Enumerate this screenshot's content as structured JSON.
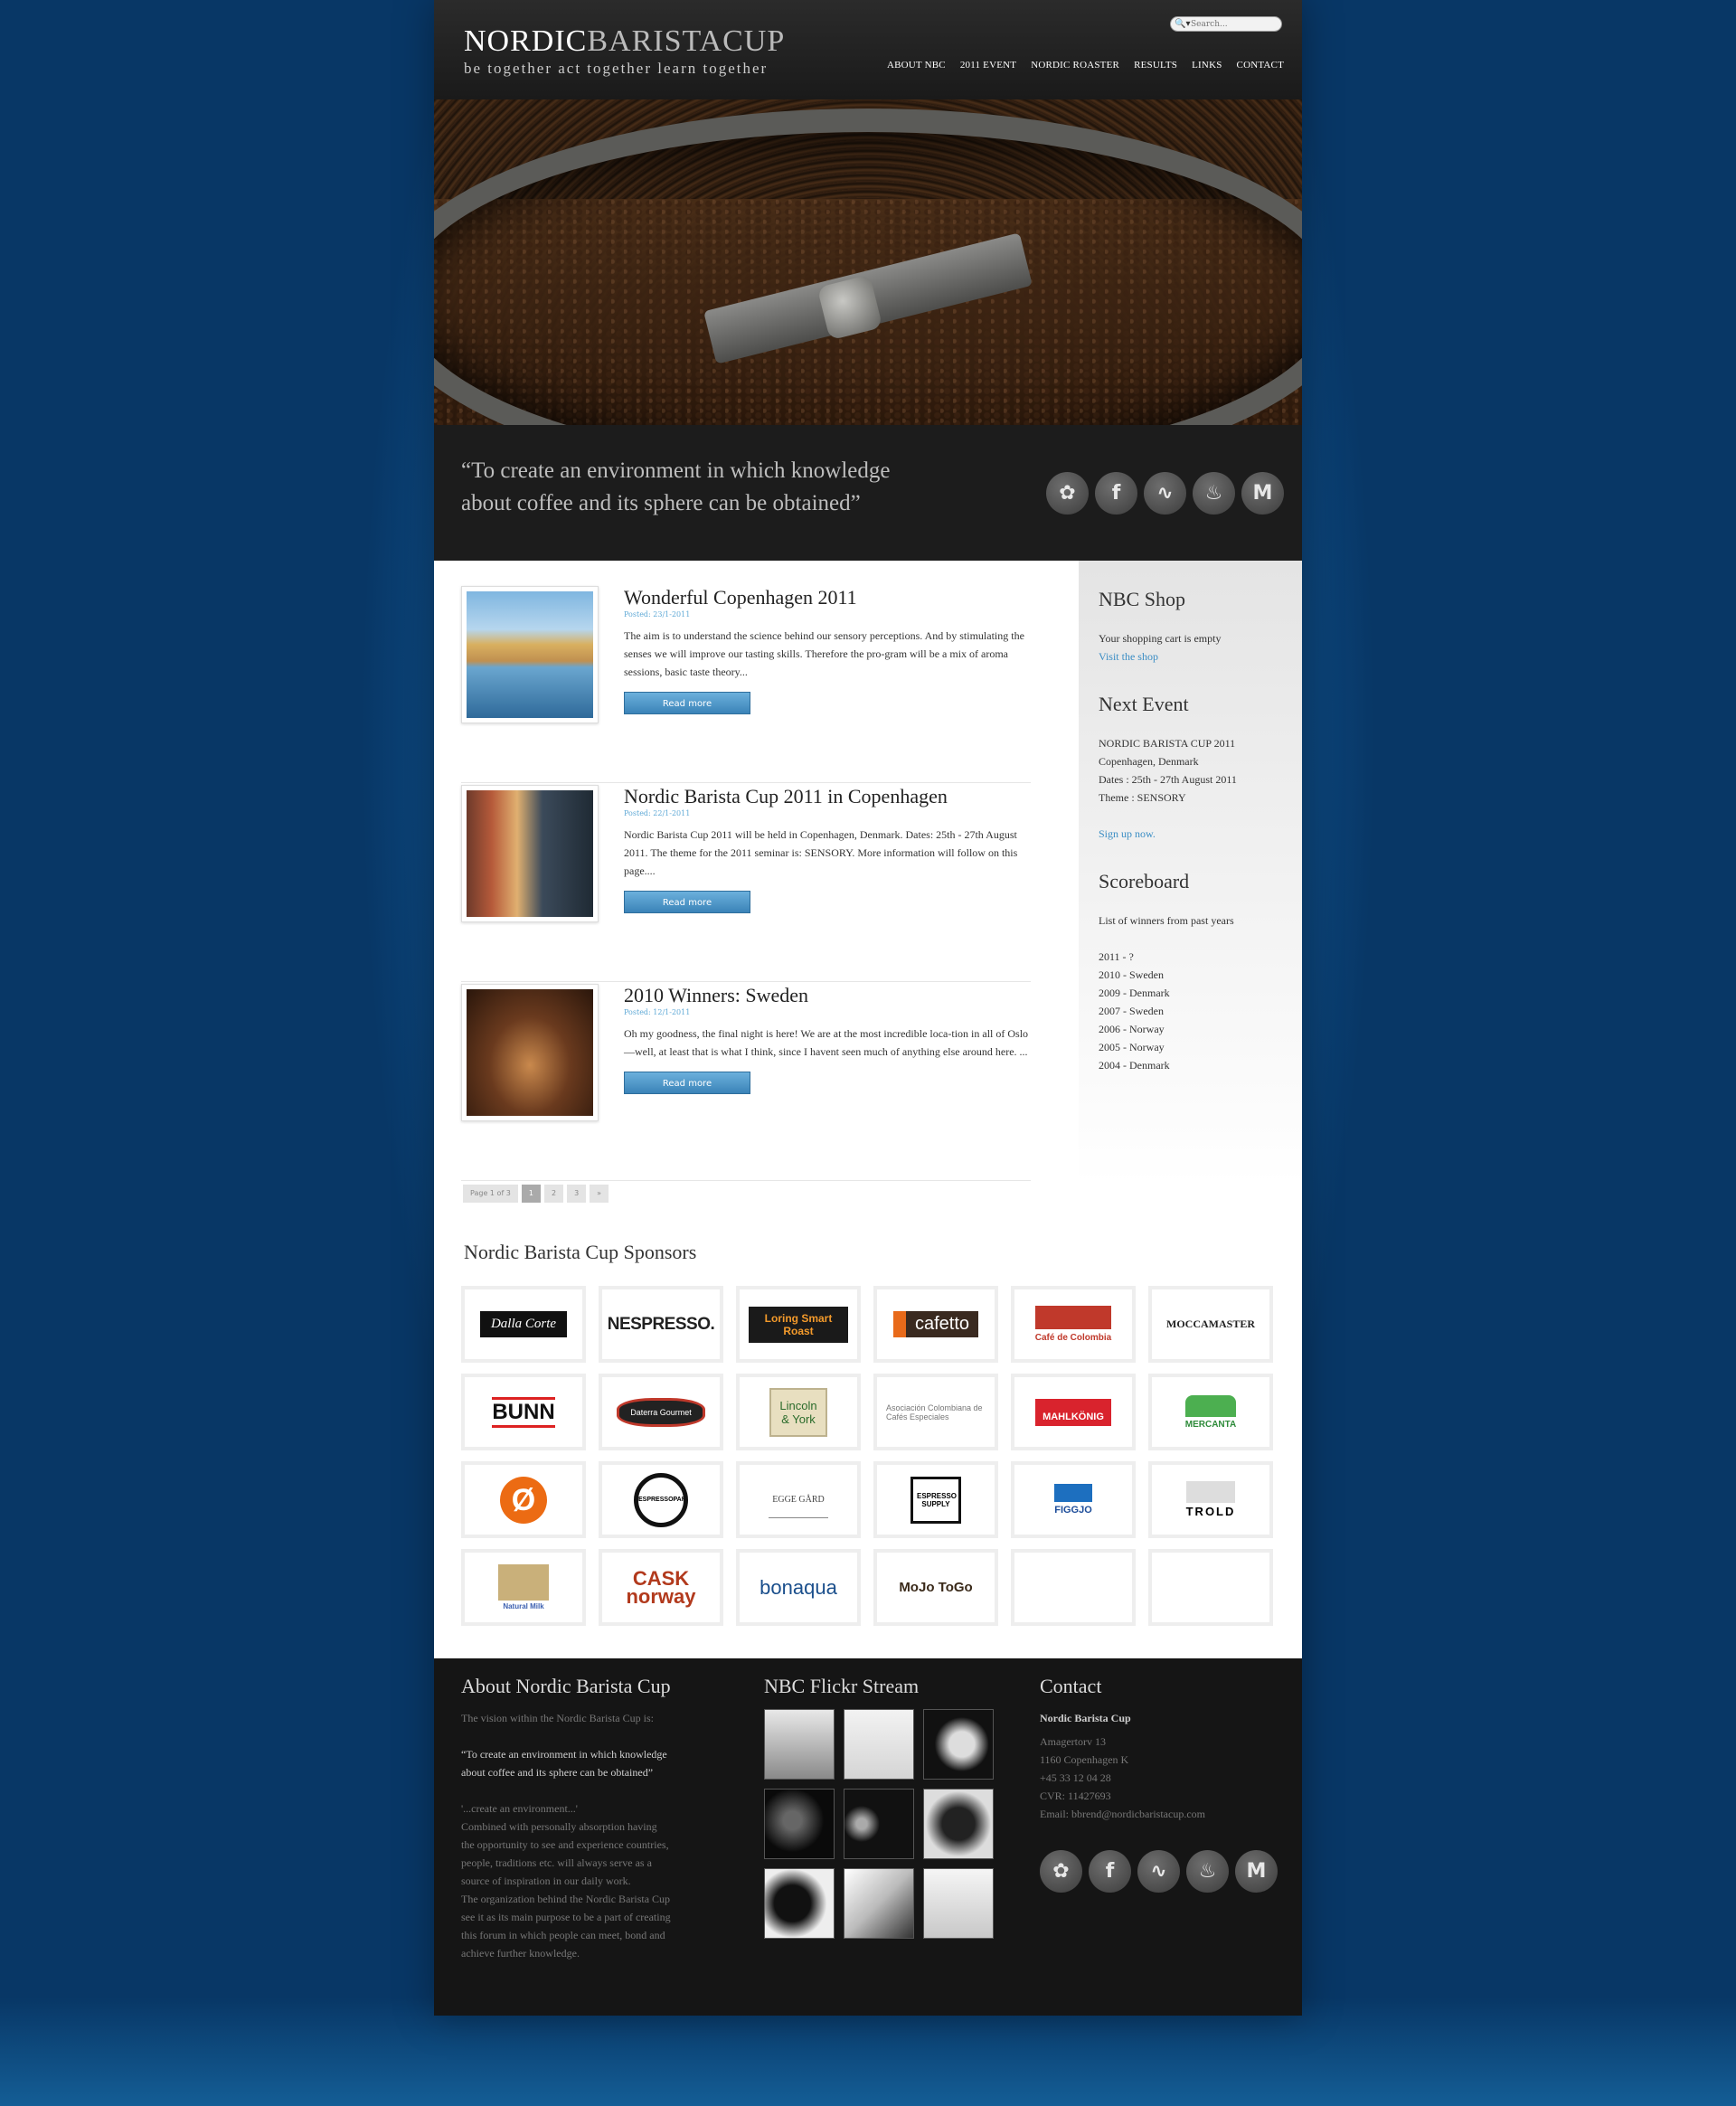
{
  "brand": {
    "name_bold": "NORDIC",
    "name_thin": "BARISTACUP",
    "tagline": "be together   act together   learn together"
  },
  "search": {
    "placeholder": "Search..."
  },
  "nav": [
    "ABOUT NBC",
    "2011 EVENT",
    "NORDIC ROASTER",
    "RESULTS",
    "LINKS",
    "CONTACT"
  ],
  "quote": {
    "line1": "“To create an environment in which knowledge",
    "line2": "about coffee and its sphere can be obtained”"
  },
  "social_icons": [
    "twitter-icon",
    "facebook-icon",
    "rss-icon",
    "flame-icon",
    "gmail-icon"
  ],
  "posts": [
    {
      "title": "Wonderful Copenhagen 2011",
      "date": "Posted: 23/1-2011",
      "text": "The aim is to understand the science behind our sensory perceptions. And by stimulating the senses we will improve our tasting skills. Therefore the pro-gram will be a mix of aroma sessions, basic taste theory...",
      "button": "Read more"
    },
    {
      "title": "Nordic Barista Cup 2011 in Copenhagen",
      "date": "Posted: 22/1-2011",
      "text": "Nordic Barista Cup 2011 will be held in Copenhagen, Denmark. Dates: 25th - 27th August 2011. The theme for the 2011 seminar is: SENSORY. More information will follow on this page....",
      "button": "Read more"
    },
    {
      "title": "2010 Winners: Sweden",
      "date": "Posted: 12/1-2011",
      "text": "Oh my goodness, the final night is here! We are at the most incredible loca-tion in all of Oslo—well, at least that is what I think, since I havent seen much of anything else around here. ...",
      "button": "Read more"
    }
  ],
  "pager": {
    "label": "Page 1 of 3",
    "pages": [
      "1",
      "2",
      "3",
      "»"
    ]
  },
  "sidebar": {
    "shop": {
      "title": "NBC Shop",
      "text": "Your shopping cart is empty",
      "link": "Visit the shop"
    },
    "event": {
      "title": "Next Event",
      "lines": [
        "NORDIC BARISTA CUP 2011",
        "Copenhagen, Denmark",
        "Dates : 25th - 27th August 2011",
        "Theme : SENSORY"
      ],
      "link": "Sign up now."
    },
    "scoreboard": {
      "title": "Scoreboard",
      "intro": "List of winners from past years",
      "rows": [
        "2011  -  ?",
        "2010  -  Sweden",
        "2009  -  Denmark",
        "2007  -  Sweden",
        "2006  -  Norway",
        "2005  -  Norway",
        "2004  -  Denmark"
      ]
    }
  },
  "sponsors": {
    "title": "Nordic Barista Cup Sponsors",
    "logos": [
      "Dalla Corte",
      "NESPRESSO.",
      "Loring Smart Roast",
      "cafetto",
      "Café de Colombia",
      "MOCCAMASTER",
      "BUNN",
      "Daterra Gourmet",
      "Lincoln & York",
      "Asociación Colombiana de Cafés Especiales",
      "MAHLKÖNIG",
      "MERCANTA",
      "Ø",
      "ESPRESSOPARTS.COM",
      "EGGE GÅRD",
      "ESPRESSO SUPPLY",
      "FIGGJO",
      "TROLD",
      "Natural Milk",
      "CASK norway",
      "bonaqua",
      "MoJo ToGo",
      "",
      ""
    ]
  },
  "footer": {
    "about": {
      "title": "About Nordic Barista Cup",
      "intro": "The vision within the Nordic Barista Cup is:",
      "quote1": "“To create an environment in which knowledge",
      "quote2": "about coffee and its sphere can be obtained”",
      "p1": "'...create an environment...'",
      "p2": "Combined with personally absorption having",
      "p3": "the opportunity to see and experience countries,",
      "p4": "people, traditions etc. will always serve as a",
      "p5": "source of inspiration in our daily work.",
      "p6": "The organization behind the Nordic Barista Cup",
      "p7": "see it as its main purpose to be a part of creating",
      "p8": "this forum in which people can meet, bond and",
      "p9": "achieve further knowledge."
    },
    "flickr": {
      "title": "NBC Flickr Stream"
    },
    "contact": {
      "title": "Contact",
      "org": "Nordic Barista Cup",
      "lines": [
        "Amagertorv 13",
        "1160 Copenhagen K",
        "+45 33 12 04 28",
        "CVR: 11427693",
        "Email: bbrend@nordicbaristacup.com"
      ]
    }
  }
}
